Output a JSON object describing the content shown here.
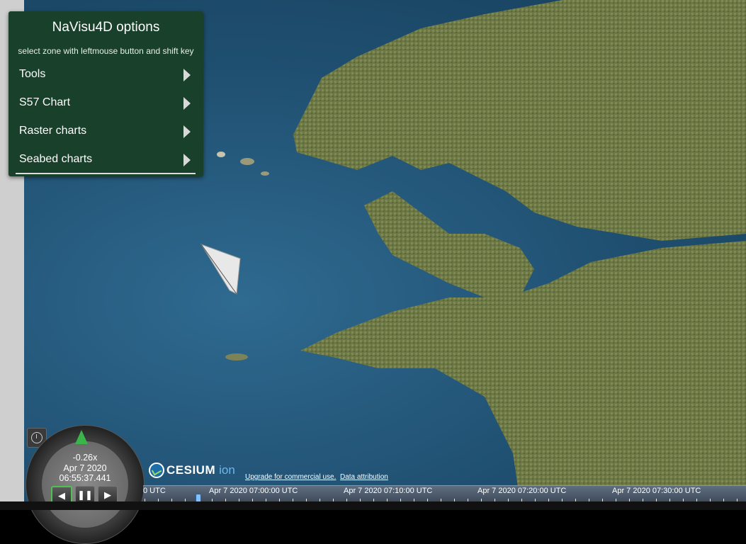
{
  "menu": {
    "title": "NaVisu4D options",
    "subtitle": "select zone with leftmouse button and shift key",
    "items": [
      {
        "label": "Tools"
      },
      {
        "label": "S57 Chart"
      },
      {
        "label": "Raster charts"
      },
      {
        "label": "Seabed charts"
      }
    ]
  },
  "animation": {
    "speed": "-0.26x",
    "date": "Apr 7 2020",
    "time": "06:55:37.441"
  },
  "credits": {
    "logo_main": "CESIUM",
    "logo_ion": "ion",
    "upgrade": "Upgrade for commercial use.",
    "attribution": "Data attribution"
  },
  "timeline": {
    "labels": [
      "0 UTC",
      "Apr 7 2020 07:00:00 UTC",
      "Apr 7 2020 07:10:00 UTC",
      "Apr 7 2020 07:20:00 UTC",
      "Apr 7 2020 07:30:00 UTC"
    ]
  },
  "colors": {
    "menu_bg": "#18402a",
    "sea": "#1f4f70",
    "land": "#6f7a45",
    "active_button": "#4ec24e"
  }
}
